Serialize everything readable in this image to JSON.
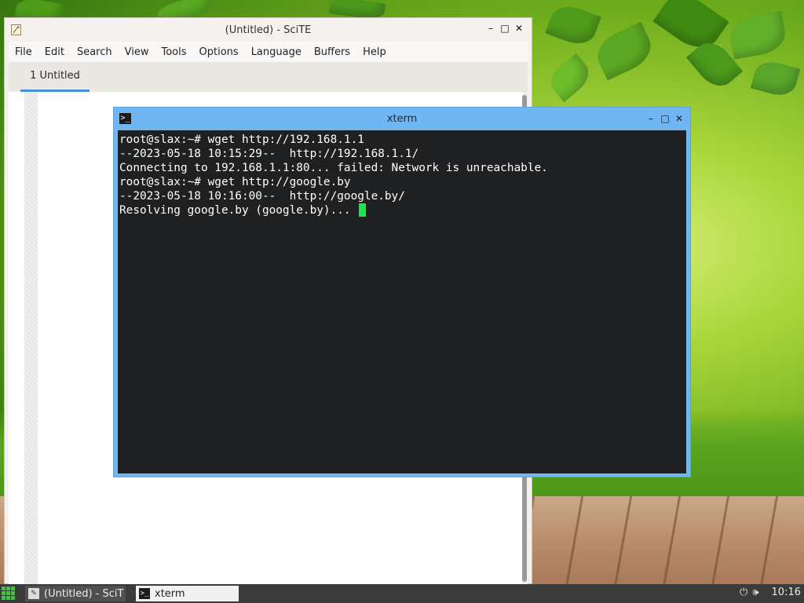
{
  "scite": {
    "title": "(Untitled) - SciTE",
    "menu": [
      "File",
      "Edit",
      "Search",
      "View",
      "Tools",
      "Options",
      "Language",
      "Buffers",
      "Help"
    ],
    "tab_label": "1 Untitled",
    "icon": "scite-app-icon"
  },
  "xterm": {
    "title": "xterm",
    "icon": "terminal-icon",
    "lines": [
      "root@slax:~# wget http://192.168.1.1",
      "--2023-05-18 10:15:29--  http://192.168.1.1/",
      "Connecting to 192.168.1.1:80... failed: Network is unreachable.",
      "root@slax:~# wget http://google.by",
      "--2023-05-18 10:16:00--  http://google.by/",
      "Resolving google.by (google.by)... "
    ],
    "cursor_color": "#19e64a"
  },
  "taskbar": {
    "tasks": [
      {
        "label": "(Untitled) - SciT",
        "icon": "scite-app-icon",
        "active": false
      },
      {
        "label": "xterm",
        "icon": "terminal-icon",
        "active": true
      }
    ],
    "tray": {
      "power_icon": "power-icon",
      "volume_icon": "volume-icon",
      "clock": "10:16"
    }
  },
  "colors": {
    "xterm_frame": "#6fb6f2",
    "terminal_bg": "#1f2021",
    "taskbar_bg": "#3b3b3b",
    "start_icon": "#43c143",
    "tab_underline": "#4a90d9"
  }
}
